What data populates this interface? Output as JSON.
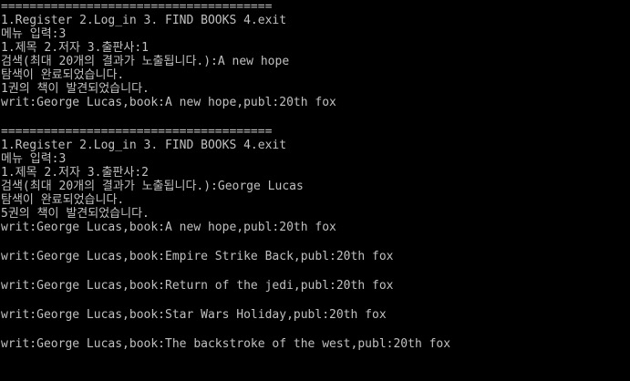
{
  "console": {
    "separator": "======================================",
    "blocks": [
      {
        "menu": "1.Register 2.Log_in 3. FIND BOOKS 4.exit",
        "menu_input": "메뉴 입력:3",
        "search_type": "1.제목 2.저자 3.출판사:1",
        "search_query": "검색(최대 20개의 결과가 노출됩니다.):A new hope",
        "status": "탐색이 완료되었습니다.",
        "count": "1권의 책이 발견되었습니다.",
        "results": [
          "writ:George Lucas,book:A new hope,publ:20th fox"
        ]
      },
      {
        "menu": "1.Register 2.Log_in 3. FIND BOOKS 4.exit",
        "menu_input": "메뉴 입력:3",
        "search_type": "1.제목 2.저자 3.출판사:2",
        "search_query": "검색(최대 20개의 결과가 노출됩니다.):George Lucas",
        "status": "탐색이 완료되었습니다.",
        "count": "5권의 책이 발견되었습니다.",
        "results": [
          "writ:George Lucas,book:A new hope,publ:20th fox",
          "writ:George Lucas,book:Empire Strike Back,publ:20th fox",
          "writ:George Lucas,book:Return of the jedi,publ:20th fox",
          "writ:George Lucas,book:Star Wars Holiday,publ:20th fox",
          "writ:George Lucas,book:The backstroke of the west,publ:20th fox"
        ]
      }
    ]
  },
  "colors": {
    "background": "#000000",
    "text": "#c0c0c0"
  }
}
